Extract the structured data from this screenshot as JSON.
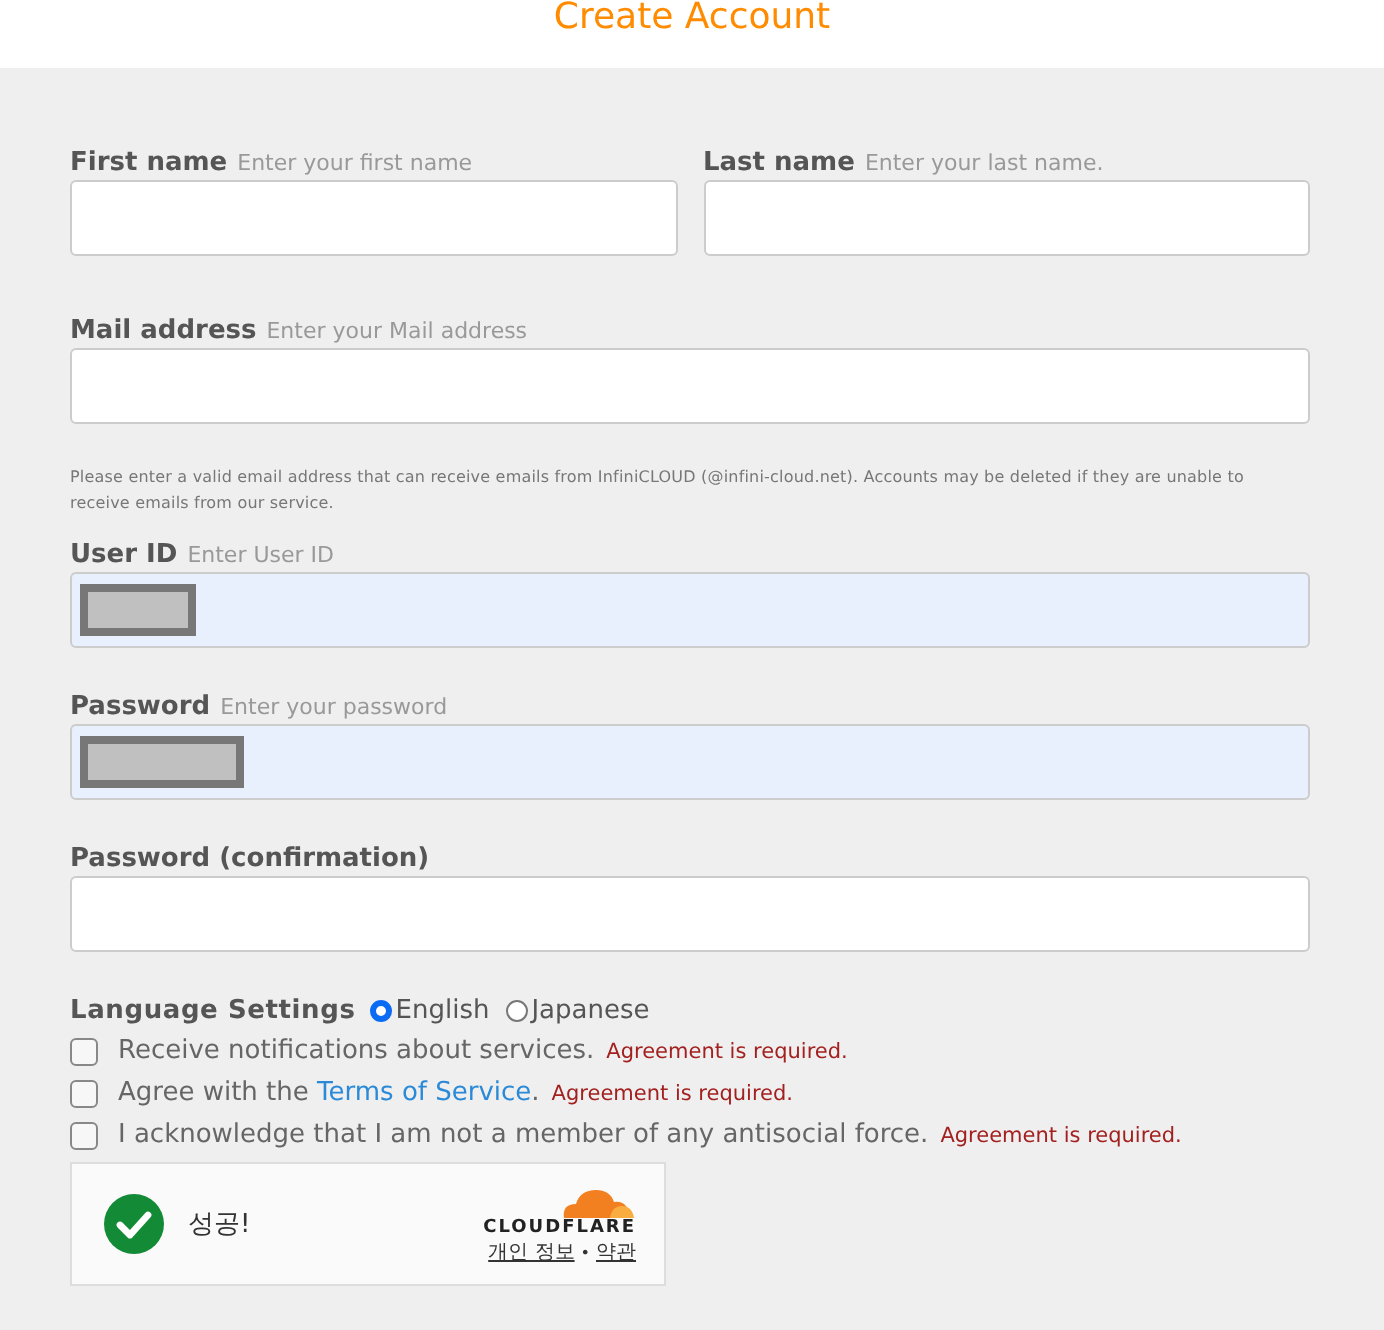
{
  "title": "Create Account",
  "field_rows": [
    {
      "fields": [
        {
          "label": "First name",
          "placeholder": "Enter your first name",
          "autofilled": false
        },
        {
          "label": "Last name",
          "placeholder": "Enter your last name.",
          "autofilled": false
        }
      ]
    },
    {
      "fields": [
        {
          "label": "Mail address",
          "placeholder": "Enter your Mail address",
          "autofilled": false
        }
      ],
      "note": "Please enter a valid email address that can receive emails from InfiniCLOUD (@infini-cloud.net). Accounts may be deleted if they are unable to receive emails from our service."
    },
    {
      "fields": [
        {
          "label": "User ID",
          "placeholder": "Enter User ID",
          "autofilled": true,
          "redacted": true
        }
      ]
    },
    {
      "fields": [
        {
          "label": "Password",
          "placeholder": "Enter your password",
          "autofilled": true,
          "redacted": true
        }
      ]
    },
    {
      "fields": [
        {
          "label": "Password (confirmation)",
          "autofilled": false
        }
      ]
    }
  ],
  "language": {
    "label": "Language Settings",
    "options": [
      {
        "label": "English",
        "selected": true
      },
      {
        "label": "Japanese",
        "selected": false
      }
    ]
  },
  "agreements": [
    {
      "text": "Receive notifications about services.",
      "checked": false,
      "error": "Agreement is required."
    },
    {
      "text": "Agree with the",
      "link": "Terms of Service",
      "text_after": ".",
      "checked": false,
      "error": "Agreement is required."
    },
    {
      "text": "I acknowledge that I am not a member of any antisocial force.",
      "checked": false,
      "error": "Agreement is required."
    }
  ],
  "captcha": {
    "status": "성공!",
    "brand": "CLOUDFLARE",
    "links": [
      "개인 정보",
      "약관"
    ],
    "separator": "•"
  }
}
